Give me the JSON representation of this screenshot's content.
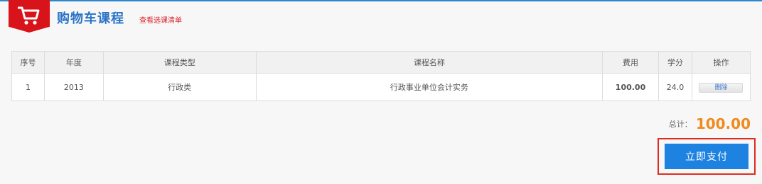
{
  "header": {
    "title": "购物车课程",
    "subtitle": "查看选课清单"
  },
  "table": {
    "columns": [
      "序号",
      "年度",
      "课程类型",
      "课程名称",
      "费用",
      "学分",
      "操作"
    ],
    "rows": [
      {
        "index": "1",
        "year": "2013",
        "type": "行政类",
        "name": "行政事业单位会计实务",
        "fee": "100.00",
        "credit": "24.0",
        "action": "删除"
      }
    ]
  },
  "summary": {
    "total_label": "总计：",
    "total_value": "100.00"
  },
  "actions": {
    "pay_label": "立即支付"
  },
  "colors": {
    "accent_blue": "#2a73c6",
    "badge_red": "#d8141a",
    "price_orange": "#f08a1c",
    "pay_button": "#1e82e0",
    "highlight_border": "#e02b20"
  },
  "icons": {
    "cart": "shopping-cart-icon"
  }
}
